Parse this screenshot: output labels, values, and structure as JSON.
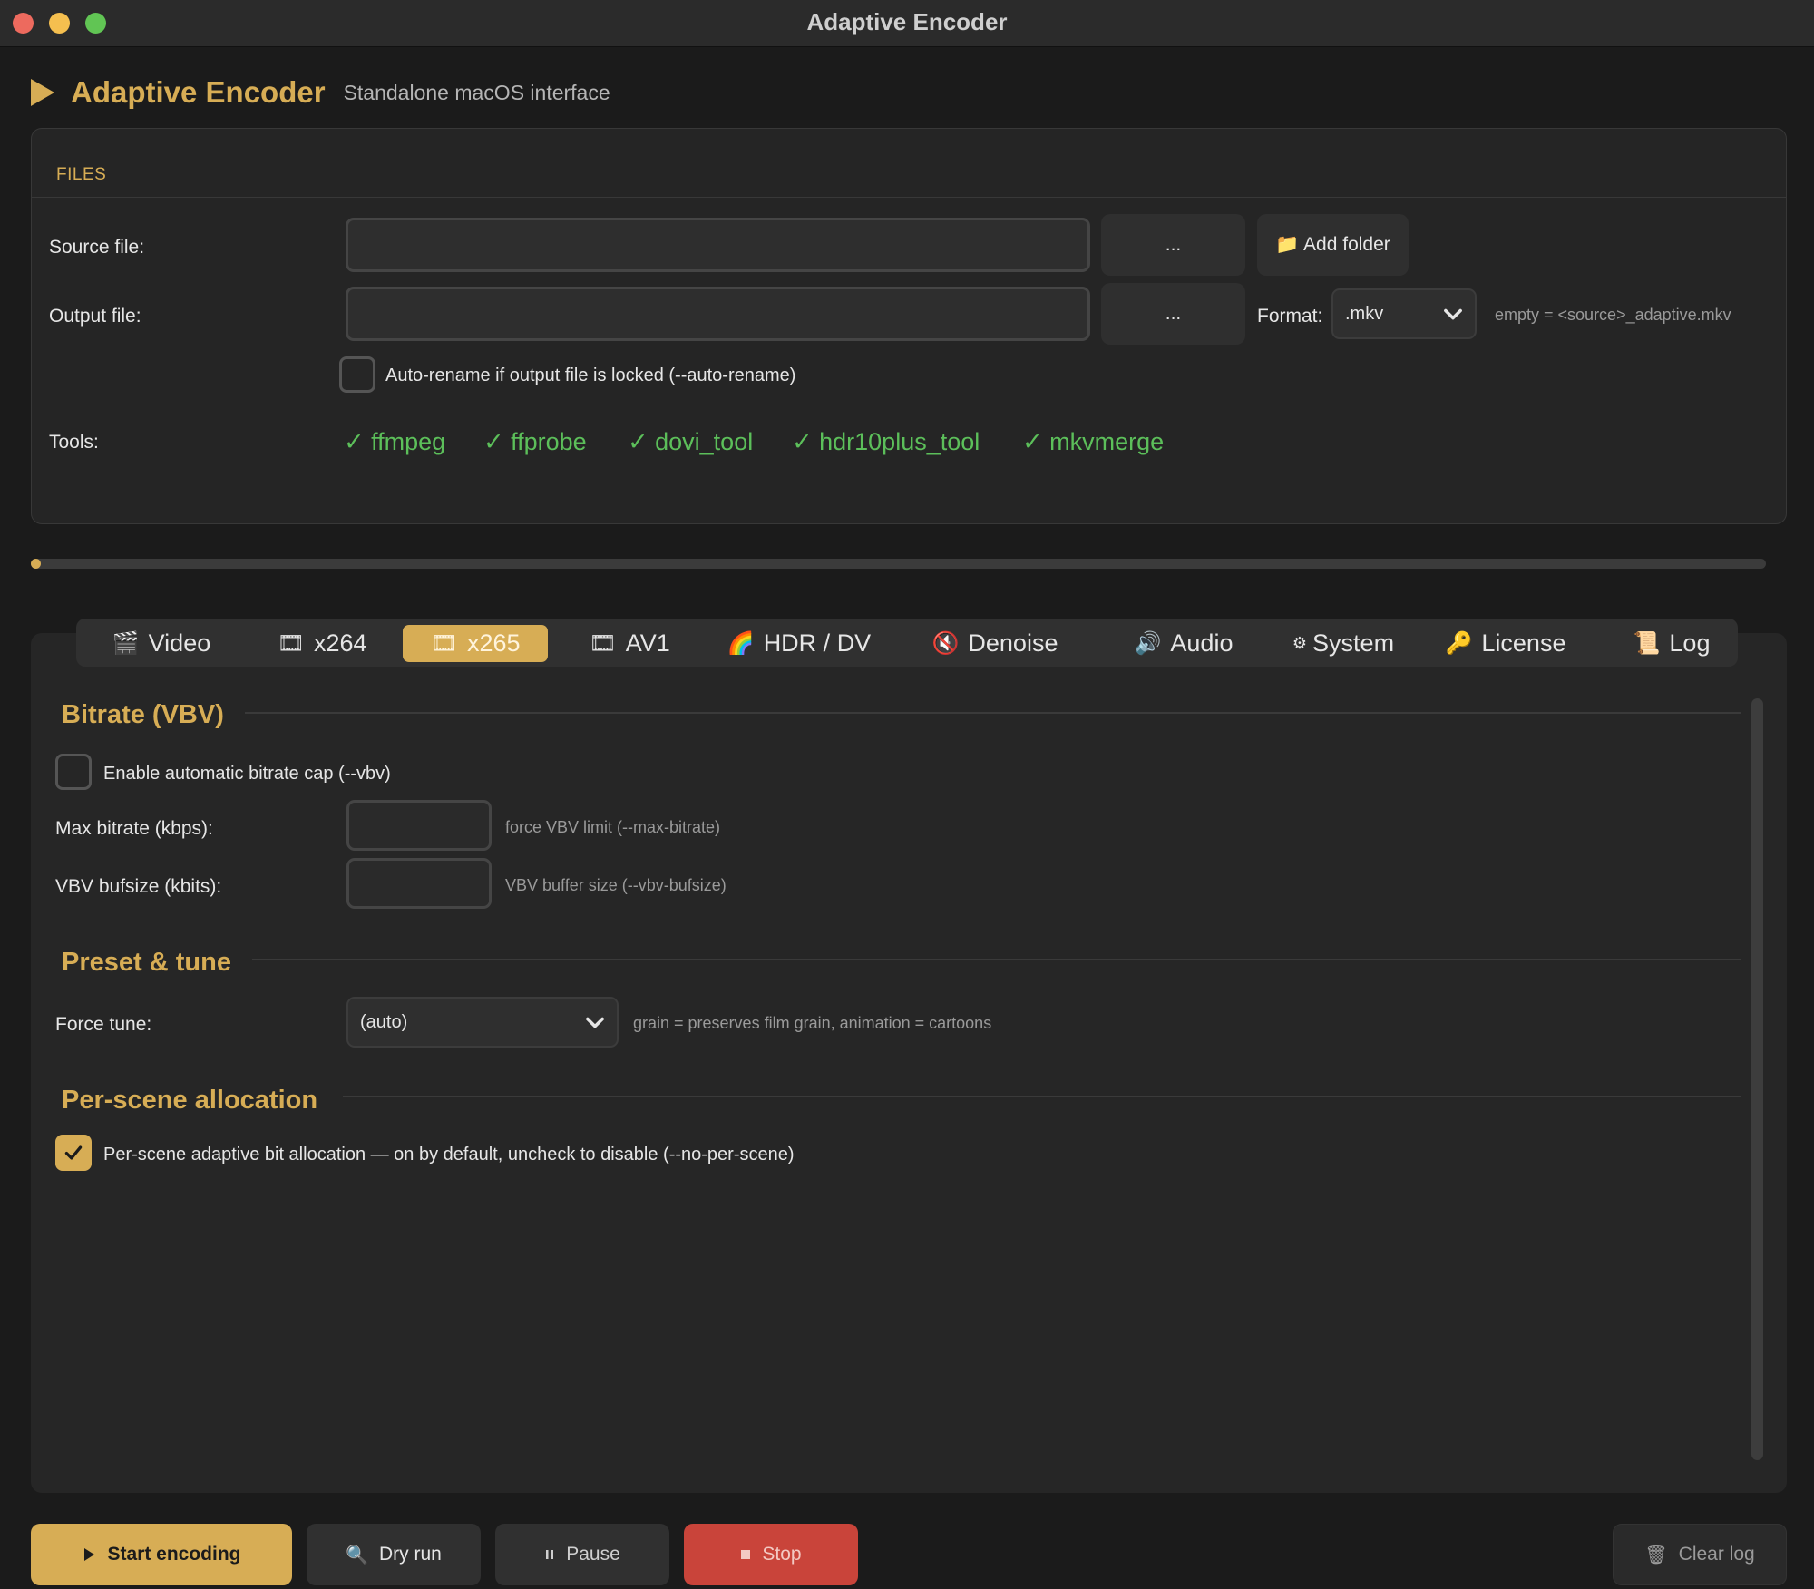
{
  "window": {
    "title": "Adaptive Encoder"
  },
  "header": {
    "app_name": "Adaptive Encoder",
    "subtitle": "Standalone macOS interface"
  },
  "files": {
    "section_label": "FILES",
    "source_label": "Source file:",
    "source_value": "",
    "browse_label": "...",
    "add_folder_label": "📁 Add folder",
    "output_label": "Output file:",
    "output_value": "",
    "format_label": "Format:",
    "format_value": ".mkv",
    "output_hint": "empty = <source>_adaptive.mkv",
    "auto_rename_label": "Auto-rename if output file is locked  (--auto-rename)",
    "auto_rename_checked": false,
    "tools_label": "Tools:",
    "tools": [
      "✓ ffmpeg",
      "✓ ffprobe",
      "✓ dovi_tool",
      "✓ hdr10plus_tool",
      "✓ mkvmerge"
    ],
    "tool_ok_color": "#5cbf5a"
  },
  "progress": {
    "fraction": 0.0
  },
  "tabs": [
    {
      "icon": "🎬",
      "label": "Video"
    },
    {
      "icon": "🎞",
      "label": "x264"
    },
    {
      "icon": "🎞",
      "label": "x265",
      "active": true
    },
    {
      "icon": "🎞",
      "label": "AV1"
    },
    {
      "icon": "🌈",
      "label": "HDR / DV"
    },
    {
      "icon": "🔇",
      "label": "Denoise"
    },
    {
      "icon": "🔊",
      "label": "Audio"
    },
    {
      "icon": "⚙",
      "label": "System"
    },
    {
      "icon": "🔑",
      "label": "License"
    },
    {
      "icon": "📜",
      "label": "Log"
    }
  ],
  "bitrate": {
    "title": "Bitrate (VBV)",
    "enable_label": "Enable automatic bitrate cap  (--vbv)",
    "enable_checked": false,
    "max_label": "Max bitrate (kbps):",
    "max_value": "",
    "max_hint": "force VBV limit  (--max-bitrate)",
    "bufsize_label": "VBV bufsize (kbits):",
    "bufsize_value": "",
    "bufsize_hint": "VBV buffer size  (--vbv-bufsize)"
  },
  "preset": {
    "title": "Preset & tune",
    "tune_label": "Force tune:",
    "tune_value": "(auto)",
    "tune_hint": "grain = preserves film grain, animation = cartoons"
  },
  "perscene": {
    "title": "Per-scene allocation",
    "label": "Per-scene adaptive bit allocation — on by default, uncheck to disable  (--no-per-scene)",
    "checked": true
  },
  "actions": {
    "start": "Start encoding",
    "dry_run": "Dry run",
    "pause": "Pause",
    "stop": "Stop",
    "clear_log": "Clear log"
  },
  "colors": {
    "accent": "#d7ad55",
    "stop": "#c9443a",
    "background": "#1b1b1b"
  }
}
